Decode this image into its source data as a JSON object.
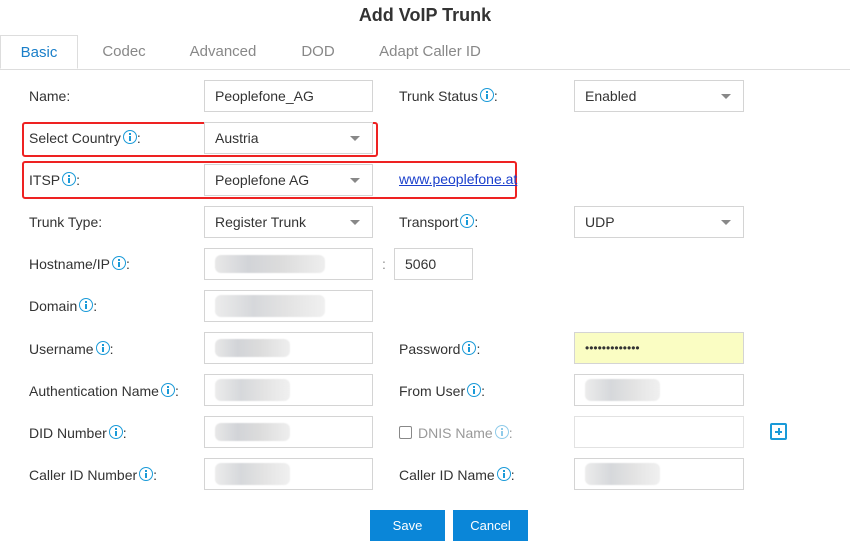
{
  "dialog": {
    "title": "Add VoIP Trunk"
  },
  "tabs": [
    {
      "label": "Basic",
      "active": true
    },
    {
      "label": "Codec",
      "active": false
    },
    {
      "label": "Advanced",
      "active": false
    },
    {
      "label": "DOD",
      "active": false
    },
    {
      "label": "Adapt Caller ID",
      "active": false
    }
  ],
  "form": {
    "name": {
      "label": "Name:",
      "value": "Peoplefone_AG"
    },
    "trunk_status": {
      "label": "Trunk Status",
      "value": "Enabled"
    },
    "select_country": {
      "label": "Select Country",
      "value": "Austria"
    },
    "itsp": {
      "label": "ITSP",
      "value": "Peoplefone AG",
      "link": "www.peoplefone.at"
    },
    "trunk_type": {
      "label": "Trunk Type:",
      "value": "Register Trunk"
    },
    "transport": {
      "label": "Transport",
      "value": "UDP"
    },
    "hostname": {
      "label": "Hostname/IP",
      "value": "[blurred]",
      "port_separator": ":",
      "port": "5060"
    },
    "domain": {
      "label": "Domain",
      "value": "[blurred]"
    },
    "username": {
      "label": "Username",
      "value": "[blurred]"
    },
    "password": {
      "label": "Password",
      "value": "•••••••••••••"
    },
    "authentication_name": {
      "label": "Authentication Name",
      "value": "[blurred]"
    },
    "from_user": {
      "label": "From User",
      "value": "[blurred]"
    },
    "did_number": {
      "label": "DID Number",
      "value": "[blurred]"
    },
    "dnis_name": {
      "label": "DNIS Name",
      "value": "",
      "checked": false
    },
    "caller_id_number": {
      "label": "Caller ID Number",
      "value": "[blurred]"
    },
    "caller_id_name": {
      "label": "Caller ID Name",
      "value": "[blurred]"
    },
    "colon": ":"
  },
  "buttons": {
    "save": "Save",
    "cancel": "Cancel"
  },
  "colors": {
    "accent": "#0a86d8",
    "highlight_box": "#ee2222",
    "password_bg": "#fafdc3"
  }
}
